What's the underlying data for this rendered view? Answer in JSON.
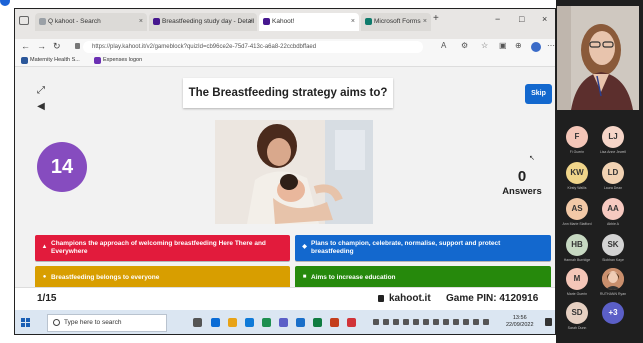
{
  "browser": {
    "tabs": [
      {
        "label": "Q   kahoot - Search"
      },
      {
        "label": "Breastfeeding study day - Detail"
      },
      {
        "label": "Kahoot!"
      },
      {
        "label": "Microsoft Forms"
      }
    ],
    "url": "https://play.kahoot.it/v2/gameblock?quizId=cb96ce2e-75d7-413c-a6a8-22ccbdbffaed",
    "favorites": [
      "Maternity Health S...",
      "Expenses logon"
    ]
  },
  "kahoot": {
    "question": "The Breastfeeding strategy aims to?",
    "skip_label": "Skip",
    "timer": "14",
    "answers_count": "0",
    "answers_label": "Answers",
    "options": [
      {
        "shape": "▲",
        "text": "Champions the approach of welcoming breastfeeding Here There and Everywhere",
        "color": "#e21b3c"
      },
      {
        "shape": "◆",
        "text": "Plans to champion, celebrate, normalise, support and protect breastfeeding",
        "color": "#1368ce"
      },
      {
        "shape": "●",
        "text": "Breastfeeding belongs to everyone",
        "color": "#d89e00"
      },
      {
        "shape": "■",
        "text": "Aims to increase education",
        "color": "#26890c"
      }
    ],
    "counter": "1/15",
    "brand": "kahoot.it",
    "pin_label": "Game PIN: 4120916"
  },
  "taskbar": {
    "search_placeholder": "Type here to search",
    "time": "13:56",
    "date": "22/09/2022"
  },
  "participants": [
    {
      "initials": "F",
      "name": "Fi Guerin",
      "color": "#f4c6b8"
    },
    {
      "initials": "LJ",
      "name": "Lisa Anne Jewell",
      "color": "#f6d5c8"
    },
    {
      "initials": "KW",
      "name": "Kirsty Wallis",
      "color": "#f0d58a"
    },
    {
      "initials": "LD",
      "name": "Laura Dean",
      "color": "#f1d2b3"
    },
    {
      "initials": "AS",
      "name": "Ann Marie Stafford",
      "color": "#f2c9a7"
    },
    {
      "initials": "AA",
      "name": "Abbie A",
      "color": "#f6c9c0"
    },
    {
      "initials": "HB",
      "name": "Hannah Burridge",
      "color": "#c7d9c2"
    },
    {
      "initials": "SK",
      "name": "Siobhan Kaye",
      "color": "#d3d3d3"
    },
    {
      "initials": "M",
      "name": "Marie Guerin",
      "color": "#f4c6b8"
    },
    {
      "initials": "",
      "name": "RUTHANN Ryan",
      "color": "#c98f6d"
    },
    {
      "initials": "SD",
      "name": "Sarah Dunn",
      "color": "#e6d0c2"
    },
    {
      "initials": "+3",
      "name": "",
      "color": "#5b5fc7"
    }
  ]
}
